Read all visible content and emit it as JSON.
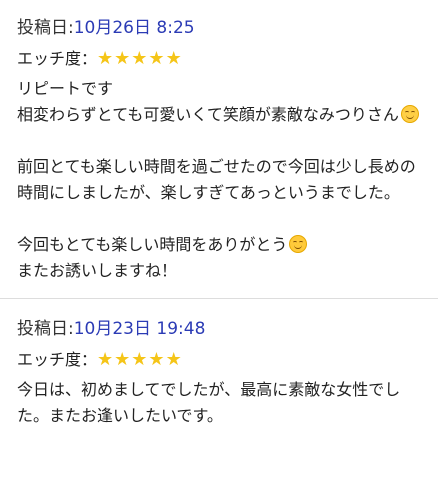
{
  "reviews": [
    {
      "post_label": "投稿日:",
      "post_date": "10月26日 8:25",
      "rating_label": "エッチ度：",
      "stars": "★★★★★",
      "paragraphs": [
        [
          "リピートです",
          "相変わらずとても可愛いくて笑顔が素敵なみつりさん"
        ],
        [
          "前回とても楽しい時間を過ごせたので今回は少し長めの時間にしましたが、楽しすぎてあっというまでした。"
        ],
        [
          "今回もとても楽しい時間をありがとう"
        ],
        [
          "またお誘いしますね！"
        ]
      ]
    },
    {
      "post_label": "投稿日:",
      "post_date": "10月23日 19:48",
      "rating_label": "エッチ度：",
      "stars": "★★★★★",
      "paragraphs": [
        [
          "今日は、初めましてでしたが、最高に素敵な女性でした。またお逢いしたいです。"
        ]
      ]
    }
  ],
  "icons": {
    "review1_line2_emoji": "relieved-face-icon",
    "review1_thanks_emoji": "smiling-face-icon"
  },
  "colors": {
    "date": "#2b3bb5",
    "stars": "#f5c518",
    "divider": "#dddddd"
  }
}
